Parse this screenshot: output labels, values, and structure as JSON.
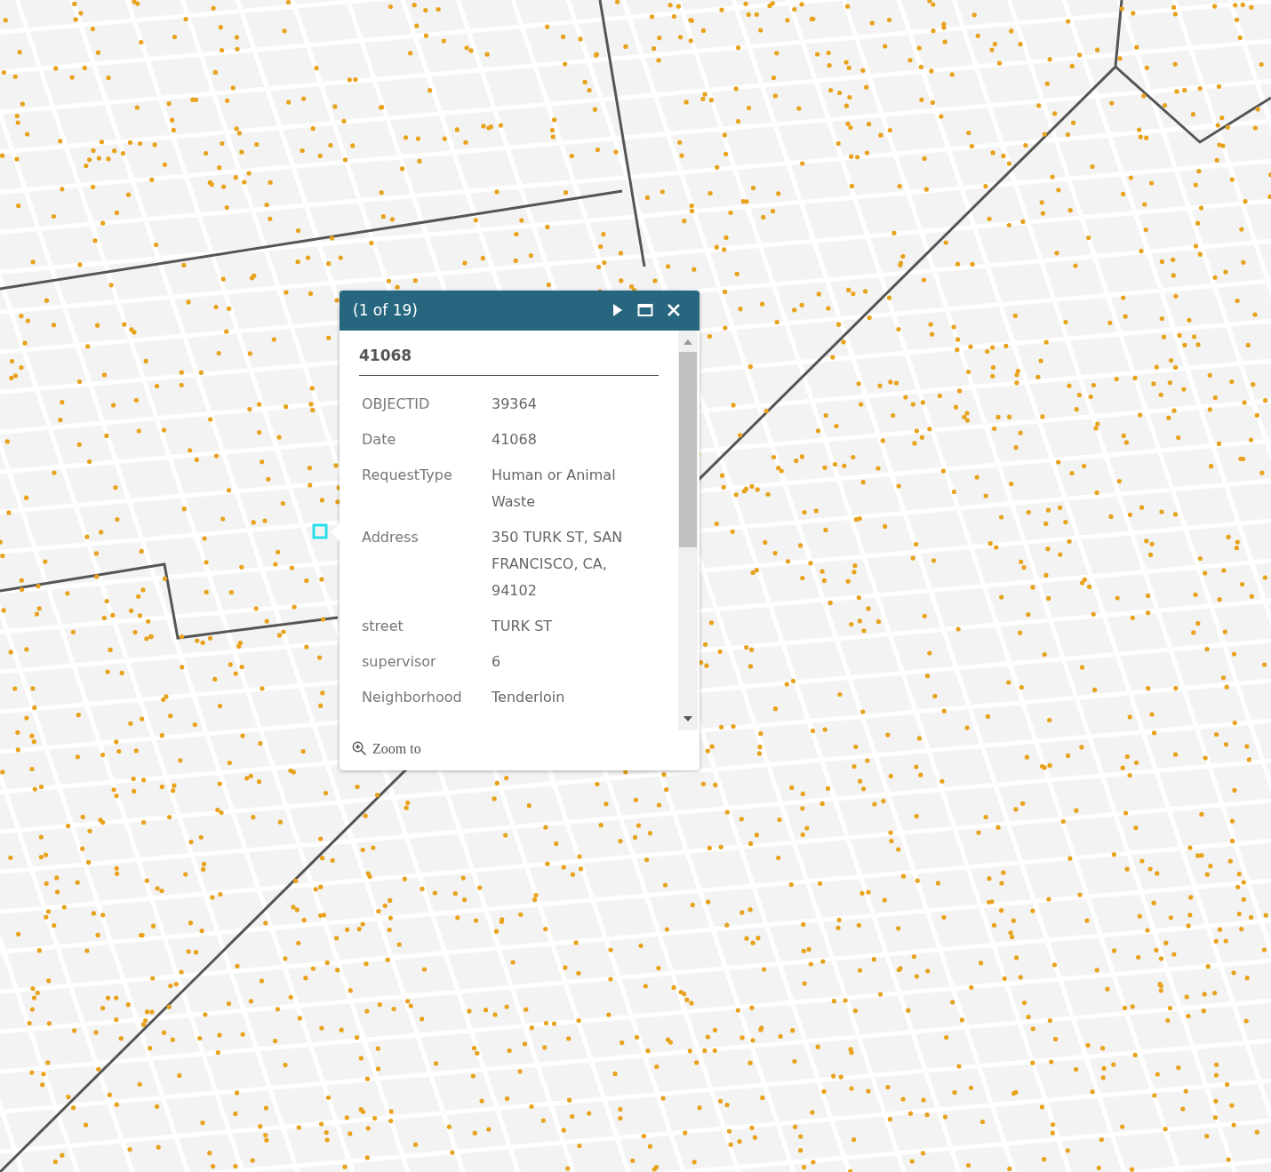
{
  "popup": {
    "counter": "(1 of 19)",
    "title": "41068",
    "fields": [
      {
        "label": "OBJECTID",
        "value": "39364"
      },
      {
        "label": "Date",
        "value": "41068"
      },
      {
        "label": "RequestType",
        "value": "Human or Animal Waste"
      },
      {
        "label": "Address",
        "value": "350 TURK ST, SAN FRANCISCO, CA, 94102"
      },
      {
        "label": "street",
        "value": "TURK ST"
      },
      {
        "label": "supervisor",
        "value": "6"
      },
      {
        "label": "Neighborhood",
        "value": "Tenderloin"
      }
    ],
    "zoom_link": "Zoom to"
  }
}
